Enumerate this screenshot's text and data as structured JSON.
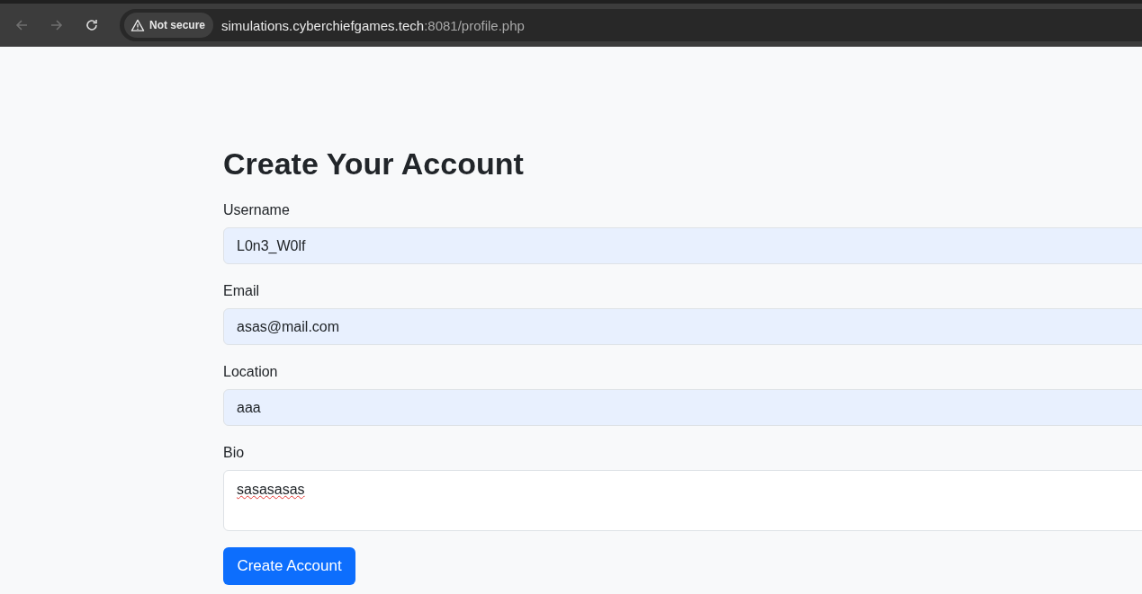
{
  "browser": {
    "security_label": "Not secure",
    "url_host": "simulations.cyberchiefgames.tech",
    "url_rest": ":8081/profile.php"
  },
  "page": {
    "title": "Create Your Account",
    "fields": [
      {
        "label": "Username",
        "kind": "input",
        "value": "L0n3_W0lf",
        "autofilled": true
      },
      {
        "label": "Email",
        "kind": "input",
        "value": "asas@mail.com",
        "autofilled": true
      },
      {
        "label": "Location",
        "kind": "input",
        "value": "aaa",
        "autofilled": true
      },
      {
        "label": "Bio",
        "kind": "textarea",
        "value": "sasasasas",
        "autofilled": false
      }
    ],
    "submit": "Create Account"
  }
}
